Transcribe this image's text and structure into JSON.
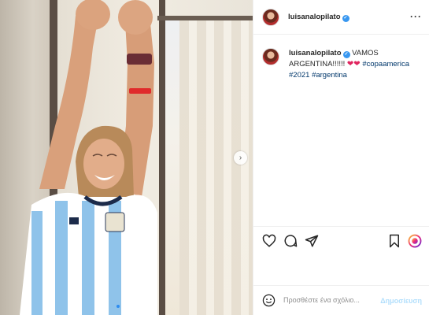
{
  "post": {
    "username": "luisanalopilato",
    "verified": true,
    "more_icon": "ellipsis-icon",
    "caption": {
      "text_start": "VAMOS ARGENTINA!!!!!!",
      "emoji": "❤❤",
      "hashtags": [
        "#copaamerica",
        "#2021",
        "#argentina"
      ]
    }
  },
  "carousel": {
    "next_icon": "chevron-right-icon",
    "slide_count": 2,
    "current_slide": 1
  },
  "actions": {
    "like_icon": "heart-icon",
    "comment_icon": "comment-icon",
    "share_icon": "send-icon",
    "save_icon": "bookmark-icon",
    "emoji_icon": "smiley-icon"
  },
  "comment": {
    "placeholder": "Προσθέστε ένα σχόλιο...",
    "post_label": "Δημοσίευση"
  },
  "colors": {
    "verified": "#3897f0",
    "hashtag": "#00376b",
    "post_button": "#b2dffc",
    "heart": "#e0245e"
  }
}
